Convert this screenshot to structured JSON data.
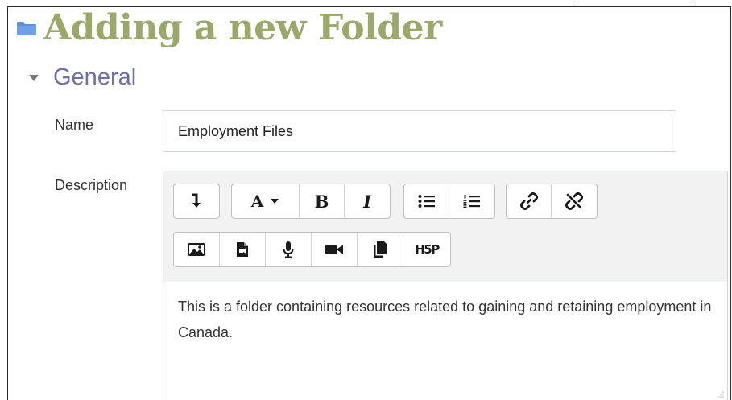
{
  "page": {
    "title": "Adding a new Folder"
  },
  "section": {
    "title": "General"
  },
  "form": {
    "name_label": "Name",
    "name_value": "Employment Files",
    "description_label": "Description",
    "description_text": "This is a folder containing resources related to gaining and retaining employment in Canada."
  },
  "toolbar": {
    "row1": [
      [
        "toolbar-toggle-icon"
      ],
      [
        "font-style-dropdown",
        "bold-button",
        "italic-button"
      ],
      [
        "unordered-list-icon",
        "ordered-list-icon"
      ],
      [
        "link-icon",
        "unlink-icon"
      ]
    ],
    "row2": [
      "insert-image-icon",
      "insert-media-icon",
      "record-audio-icon",
      "record-video-icon",
      "manage-files-icon",
      "h5p-icon"
    ],
    "font_style_label": "A",
    "bold_label": "B",
    "italic_label": "I",
    "h5p_label": "H5P"
  },
  "colors": {
    "title": "#9aa86a",
    "section": "#6c6fa5",
    "folder_icon": "#5b8fd6"
  }
}
